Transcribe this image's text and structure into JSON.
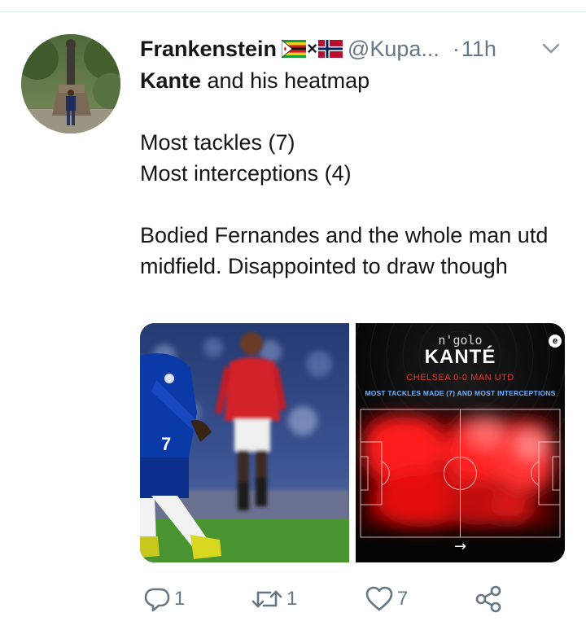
{
  "tweet": {
    "author": {
      "display_name": "Frankenstein",
      "flags": [
        "zimbabwe-flag",
        "norway-flag"
      ],
      "flag_separator": "×",
      "handle": "@Kupa...",
      "avatar": "statue-photo"
    },
    "separator": "·",
    "time": "11h",
    "menu_icon": "chevron-down-icon",
    "text": {
      "bold_word": "Kante",
      "first_line_rest": " and his heatmap",
      "stat_1": "Most tackles (7)",
      "stat_2": "Most interceptions (4)",
      "paragraph": "Bodied Fernandes and the whole man utd midfield. Disappointed to draw though"
    },
    "media": {
      "left_photo": "football-match-photo",
      "heatmap": {
        "subtitle": "n'golo",
        "title": "KANTÉ",
        "score": "CHELSEA 0-0 MAN UTD",
        "caption": "MOST TACKLES MADE (7) AND MOST INTERCEPTIONS",
        "logo": "e",
        "direction_arrow": "→",
        "colors": {
          "background": "#050505",
          "heat": "#ff2020",
          "score_text": "#e53a3a",
          "caption_text": "#6fb0ff"
        }
      }
    },
    "actions": {
      "replies": "1",
      "retweets": "1",
      "likes": "7",
      "reply_icon": "reply-icon",
      "retweet_icon": "retweet-icon",
      "like_icon": "heart-icon",
      "share_icon": "share-icon"
    },
    "colors": {
      "text": "#14171a",
      "secondary": "#657786",
      "divider": "#e1e8ed"
    }
  }
}
